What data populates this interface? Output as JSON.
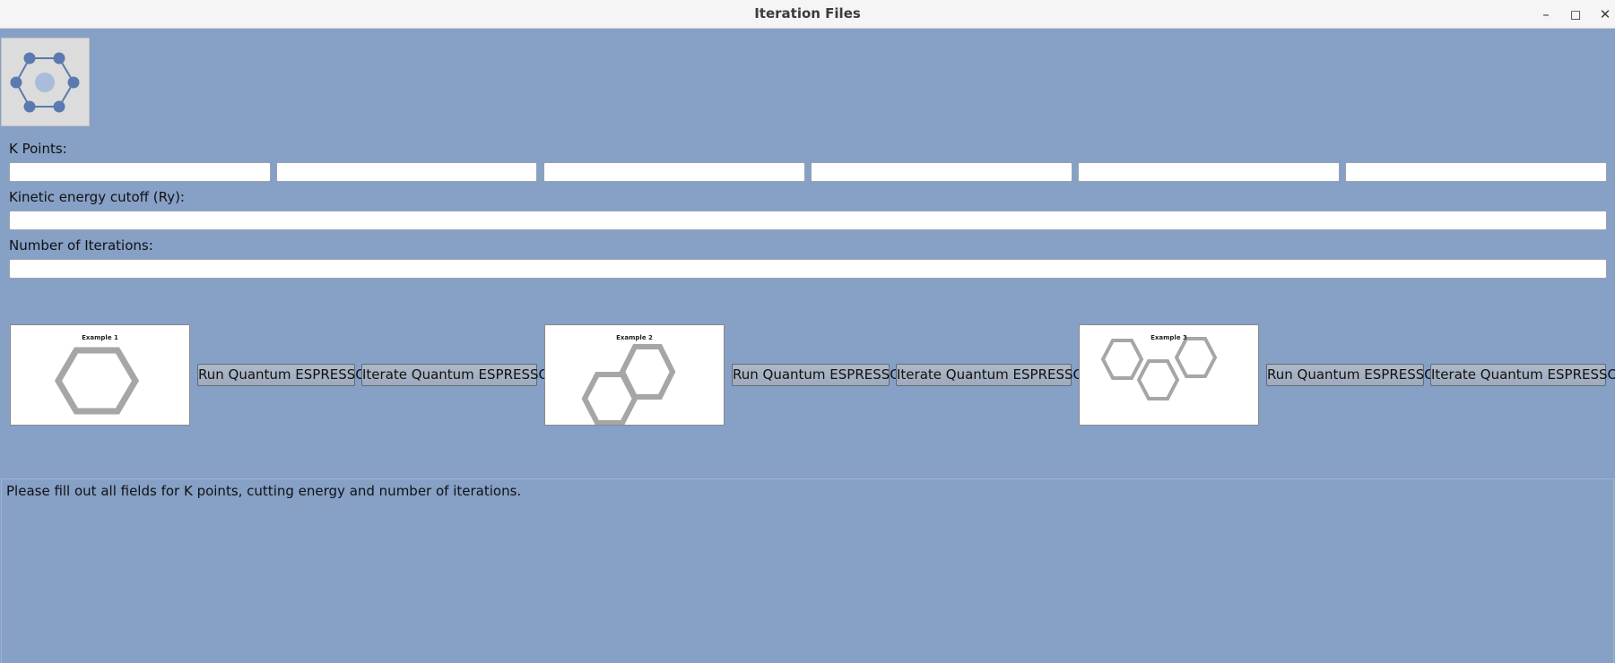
{
  "window": {
    "title": "Iteration Files"
  },
  "form": {
    "kpoints_label": "K Points:",
    "kpoints": [
      "",
      "",
      "",
      "",
      "",
      ""
    ],
    "ecut_label": "Kinetic energy cutoff (Ry):",
    "ecut_value": "",
    "iterations_label": "Number of Iterations:",
    "iterations_value": ""
  },
  "examples": [
    {
      "title": "Example 1",
      "run_label": "Run Quantum ESPRESSO",
      "iterate_label": "Iterate Quantum ESPRESSO"
    },
    {
      "title": "Example 2",
      "run_label": "Run Quantum ESPRESSO",
      "iterate_label": "Iterate Quantum ESPRESSO"
    },
    {
      "title": "Example 3",
      "run_label": "Run Quantum ESPRESSO",
      "iterate_label": "Iterate Quantum ESPRESSO"
    }
  ],
  "output": {
    "message": "Please fill out all fields for K points, cutting energy and number of iterations."
  },
  "icons": {
    "window_minimize": "minimize-icon",
    "window_maximize": "maximize-icon",
    "window_close": "close-icon",
    "logo": "molecule-logo-icon"
  },
  "colors": {
    "background": "#86a0c6",
    "logo_accent": "#5a7ab0",
    "hexagon": "#a6a6a6"
  }
}
